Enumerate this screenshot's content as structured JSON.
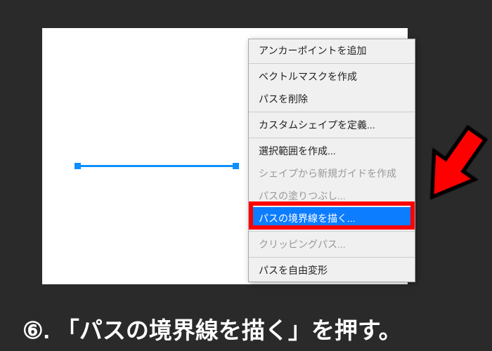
{
  "menu": {
    "items": [
      {
        "label": "アンカーポイントを追加",
        "enabled": true
      },
      {
        "separator": true
      },
      {
        "label": "ベクトルマスクを作成",
        "enabled": true
      },
      {
        "label": "パスを削除",
        "enabled": true
      },
      {
        "separator": true
      },
      {
        "label": "カスタムシェイプを定義...",
        "enabled": true
      },
      {
        "separator": true
      },
      {
        "label": "選択範囲を作成...",
        "enabled": true
      },
      {
        "label": "シェイプから新規ガイドを作成",
        "enabled": false
      },
      {
        "label": "パスの塗りつぶし...",
        "enabled": false
      },
      {
        "label": "パスの境界線を描く...",
        "enabled": true,
        "highlighted": true
      },
      {
        "separator": true
      },
      {
        "label": "クリッピングパス...",
        "enabled": false
      },
      {
        "separator": true
      },
      {
        "label": "パスを自由変形",
        "enabled": true
      }
    ]
  },
  "instruction": {
    "step": "⑥",
    "text": ". 「パスの境界線を描く」を押す。"
  },
  "colors": {
    "accent": "#0d8fff",
    "highlight_border": "#ff0000",
    "menu_highlight": "#0d7dff",
    "arrow": "#ff0000",
    "background": "#2a2a2a"
  }
}
